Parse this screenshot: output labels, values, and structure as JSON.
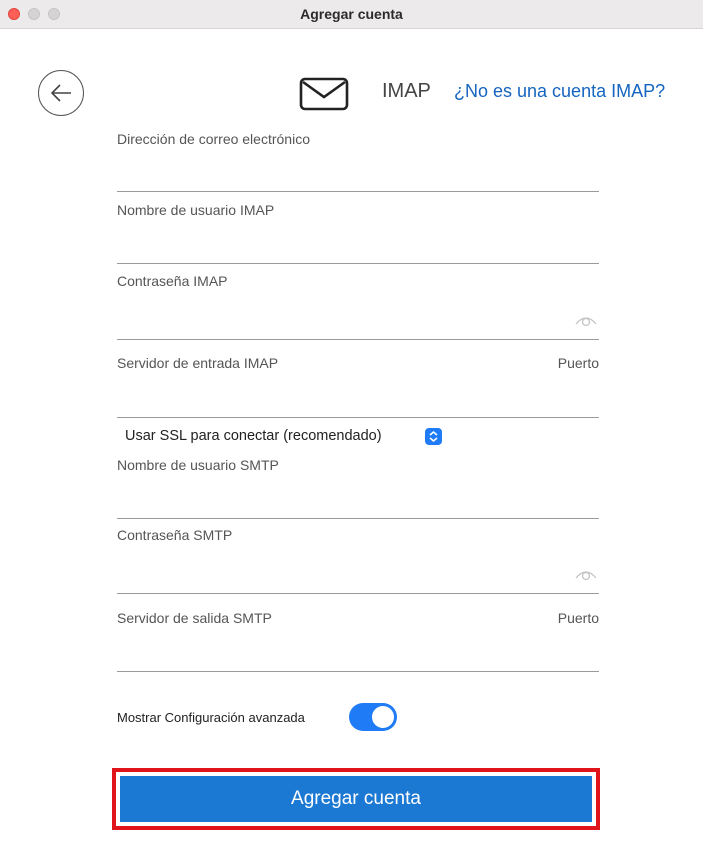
{
  "window": {
    "title": "Agregar cuenta"
  },
  "header": {
    "protocol": "IMAP",
    "not_imap_link": "¿No es una cuenta IMAP?"
  },
  "fields": {
    "email": {
      "label": "Dirección de correo electrónico",
      "value": ""
    },
    "imap_username": {
      "label": "Nombre de usuario IMAP",
      "value": ""
    },
    "imap_password": {
      "label": "Contraseña IMAP",
      "value": ""
    },
    "imap_server": {
      "label": "Servidor de entrada IMAP",
      "port_label": "Puerto",
      "value": ""
    },
    "smtp_username": {
      "label": "Nombre de usuario SMTP",
      "value": ""
    },
    "smtp_password": {
      "label": "Contraseña SMTP",
      "value": ""
    },
    "smtp_server": {
      "label": "Servidor de salida SMTP",
      "port_label": "Puerto",
      "value": ""
    }
  },
  "ssl": {
    "selected": "Usar SSL para conectar (recomendado)"
  },
  "advanced": {
    "label": "Mostrar Configuración avanzada",
    "enabled": true
  },
  "submit": {
    "label": "Agregar cuenta"
  },
  "colors": {
    "accent": "#1f7cf6",
    "button": "#1c79d3",
    "highlight_border": "#e0141b",
    "link": "#1565c0"
  }
}
